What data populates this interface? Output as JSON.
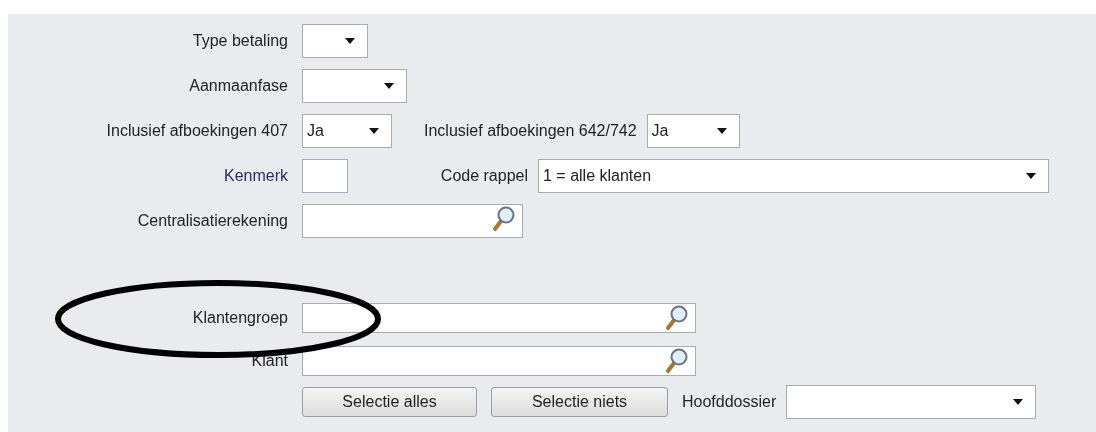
{
  "rows": [
    {
      "label": "Type betaling",
      "emphasis": false,
      "control": {
        "kind": "dropdown"
      }
    },
    {
      "label": "Aanmaanfase",
      "emphasis": false,
      "control": {
        "kind": "dropdown"
      }
    },
    {
      "label": "Inclusief afboekingen 407",
      "emphasis": false,
      "control": {
        "kind": "dropdown",
        "value": "Ja"
      },
      "extra": {
        "label": "Inclusief afboekingen 642/742",
        "control": {
          "kind": "dropdown",
          "value": "Ja"
        }
      }
    },
    {
      "label": "Kenmerk",
      "emphasis": true,
      "control": {
        "kind": "text"
      },
      "extra": {
        "label": "Code rappel",
        "control": {
          "kind": "dropdown",
          "value": "1 = alle klanten"
        }
      }
    },
    {
      "label": "Centralisatierekening",
      "emphasis": false,
      "control": {
        "kind": "lookup"
      }
    },
    {
      "label": "Klantengroep",
      "emphasis": false,
      "control": {
        "kind": "lookup"
      }
    },
    {
      "label": "Klant",
      "emphasis": false,
      "control": {
        "kind": "lookup"
      }
    },
    {
      "buttons": [
        "Selectie alles",
        "Selectie niets"
      ],
      "extra": {
        "label": "Hoofddossier",
        "control": {
          "kind": "dropdown"
        }
      }
    }
  ]
}
